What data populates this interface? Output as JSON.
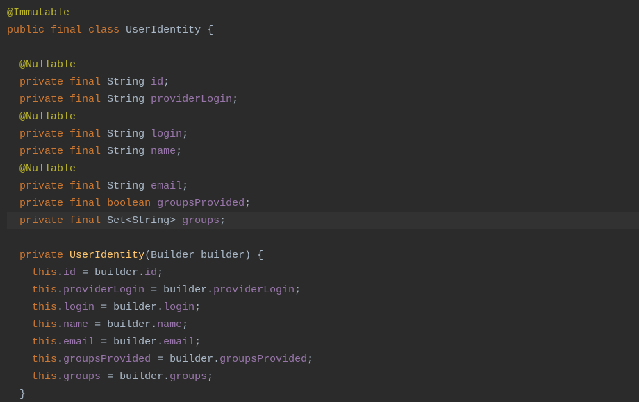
{
  "annotations": {
    "immutable": "@Immutable",
    "nullable": "@Nullable"
  },
  "keywords": {
    "public": "public",
    "final": "final",
    "class": "class",
    "private": "private",
    "boolean": "boolean",
    "this": "this"
  },
  "types": {
    "string": "String",
    "set_string": "Set<String>",
    "builder": "Builder"
  },
  "class_name": "UserIdentity",
  "fields": {
    "id": "id",
    "providerLogin": "providerLogin",
    "login": "login",
    "name": "name",
    "email": "email",
    "groupsProvided": "groupsProvided",
    "groups": "groups"
  },
  "ctor": {
    "name": "UserIdentity",
    "param_name": "builder",
    "builder_ref": "builder"
  },
  "punct": {
    "semicolon": ";",
    "open_brace": "{",
    "close_brace": "}",
    "open_paren": "(",
    "close_paren": ")",
    "space": " ",
    "dot": ".",
    "equals": " = "
  }
}
